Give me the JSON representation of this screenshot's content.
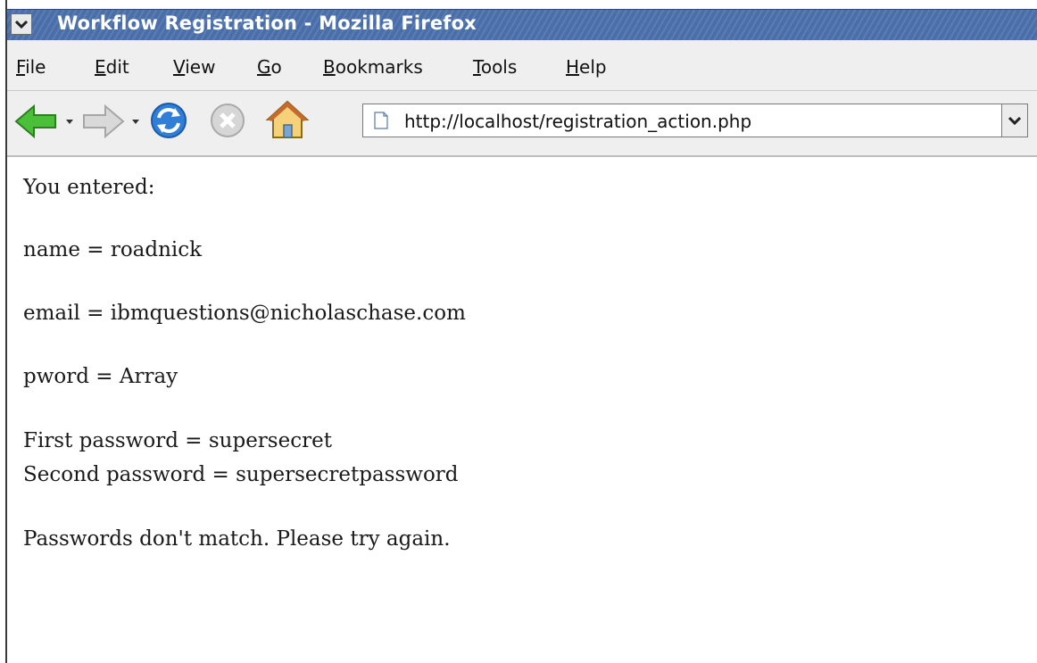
{
  "window": {
    "title": "Workflow Registration - Mozilla Firefox"
  },
  "menu": {
    "items": [
      {
        "first": "F",
        "rest": "ile"
      },
      {
        "first": "E",
        "rest": "dit"
      },
      {
        "first": "V",
        "rest": "iew"
      },
      {
        "first": "G",
        "rest": "o"
      },
      {
        "first": "B",
        "rest": "ookmarks"
      },
      {
        "first": "T",
        "rest": "ools"
      },
      {
        "first": "H",
        "rest": "elp"
      }
    ]
  },
  "toolbar": {
    "back_icon": "back-arrow-icon",
    "forward_icon": "forward-arrow-icon",
    "reload_icon": "reload-icon",
    "stop_icon": "stop-icon",
    "home_icon": "home-icon",
    "url": "http://localhost/registration_action.php"
  },
  "content": {
    "lines": [
      "You entered:",
      "name = roadnick",
      "email = ibmquestions@nicholaschase.com",
      "pword = Array",
      "First password = supersecret",
      "Second password = supersecretpassword",
      "Passwords don't match. Please try again."
    ]
  },
  "colors": {
    "titlebar": "#4a6ea9",
    "chrome": "#efefef",
    "back_arrow": "#4bbf3a",
    "reload": "#2f7fd8"
  }
}
